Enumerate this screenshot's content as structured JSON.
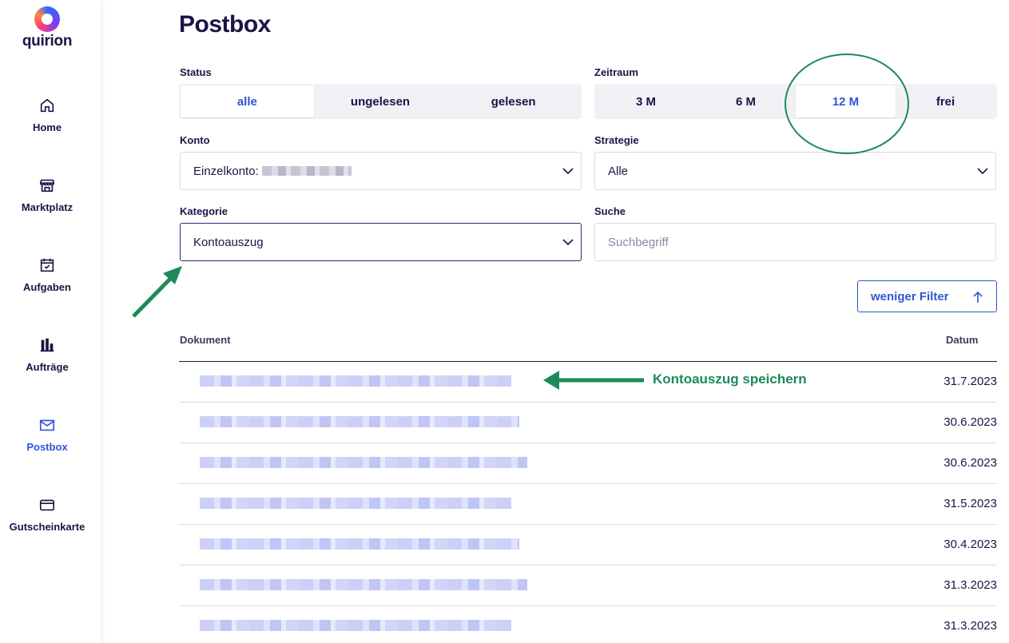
{
  "app": {
    "logo_text": "quirion"
  },
  "sidebar": {
    "items": [
      {
        "label": "Home",
        "icon": "home-icon",
        "active": false
      },
      {
        "label": "Marktplatz",
        "icon": "store-icon",
        "active": false
      },
      {
        "label": "Aufgaben",
        "icon": "calendar-check-icon",
        "active": false
      },
      {
        "label": "Aufträge",
        "icon": "bar-chart-icon",
        "active": false
      },
      {
        "label": "Postbox",
        "icon": "mail-icon",
        "active": true
      },
      {
        "label": "Gutscheinkarte",
        "icon": "card-icon",
        "active": false
      }
    ]
  },
  "page": {
    "title": "Postbox"
  },
  "filters": {
    "status": {
      "label": "Status",
      "options": [
        "alle",
        "ungelesen",
        "gelesen"
      ],
      "selected": "alle"
    },
    "zeitraum": {
      "label": "Zeitraum",
      "options": [
        "3 M",
        "6 M",
        "12 M",
        "frei"
      ],
      "selected": "12 M"
    },
    "konto": {
      "label": "Konto",
      "value_prefix": "Einzelkonto:"
    },
    "strategie": {
      "label": "Strategie",
      "value": "Alle"
    },
    "kategorie": {
      "label": "Kategorie",
      "value": "Kontoauszug"
    },
    "suche": {
      "label": "Suche",
      "placeholder": "Suchbegriff",
      "value": ""
    },
    "toggle_label": "weniger Filter"
  },
  "table": {
    "headers": {
      "document": "Dokument",
      "date": "Datum"
    },
    "rows": [
      {
        "date": "31.7.2023"
      },
      {
        "date": "30.6.2023"
      },
      {
        "date": "30.6.2023"
      },
      {
        "date": "31.5.2023"
      },
      {
        "date": "30.4.2023"
      },
      {
        "date": "31.3.2023"
      },
      {
        "date": "31.3.2023"
      }
    ]
  },
  "annotations": {
    "arrow_text": "Kontoauszug speichern",
    "color": "#1e8a5a"
  },
  "colors": {
    "accent": "#2f55d4",
    "text": "#1a1446",
    "annotation": "#1e8a5a"
  }
}
